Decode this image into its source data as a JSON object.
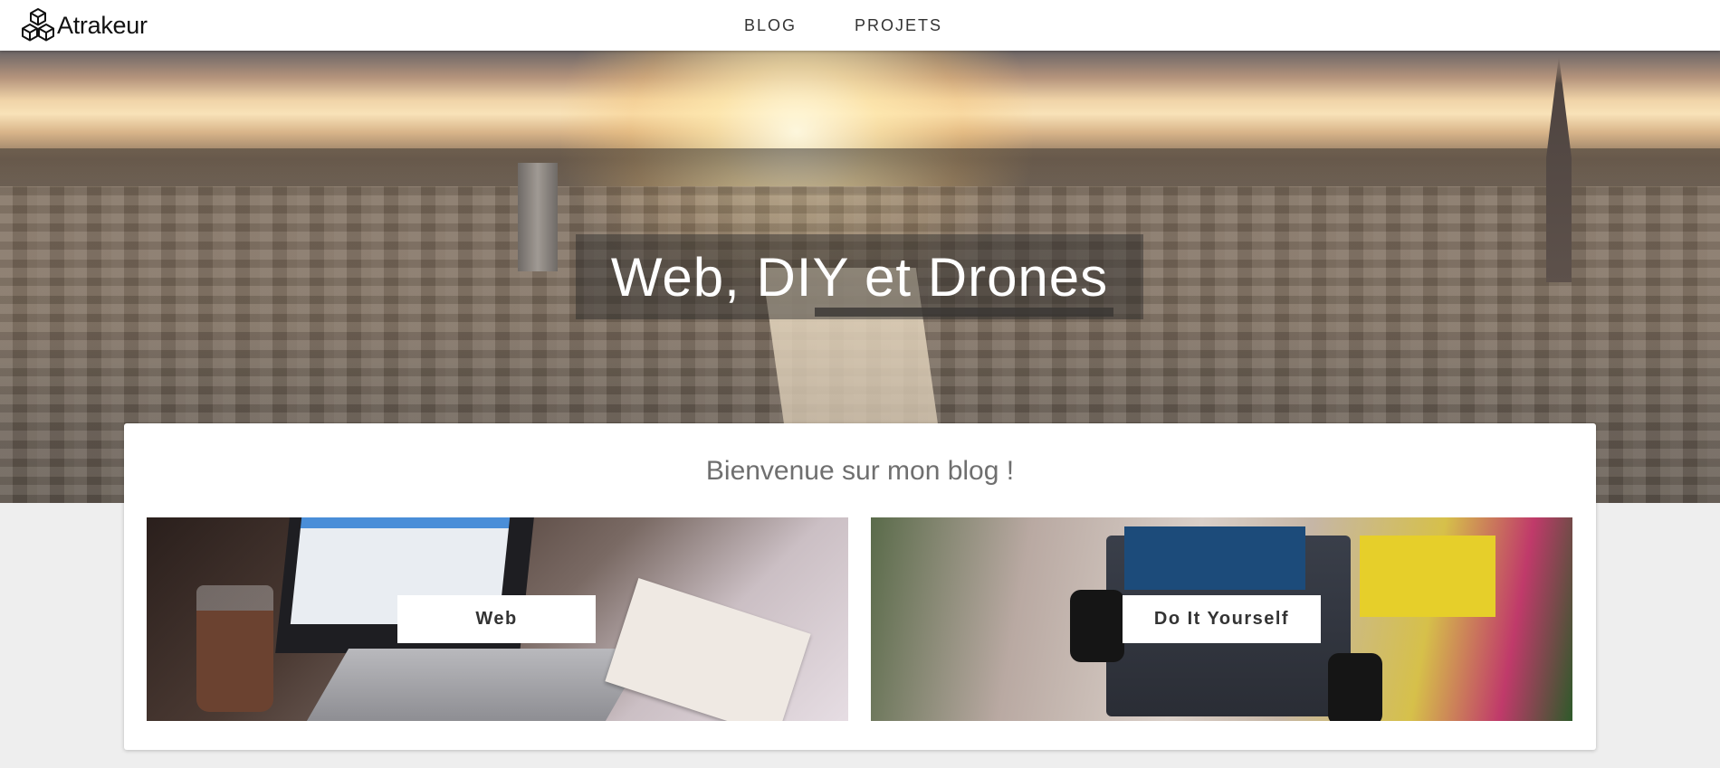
{
  "navbar": {
    "brand_name": "Atrakeur",
    "brand_icon": "cubes-logo-icon",
    "links": [
      {
        "label": "BLOG"
      },
      {
        "label": "PROJETS"
      }
    ]
  },
  "hero": {
    "title": "Web, DIY et Drones"
  },
  "main": {
    "welcome_title": "Bienvenue sur mon blog !",
    "tiles": [
      {
        "label": "Web"
      },
      {
        "label": "Do It Yourself"
      }
    ]
  }
}
